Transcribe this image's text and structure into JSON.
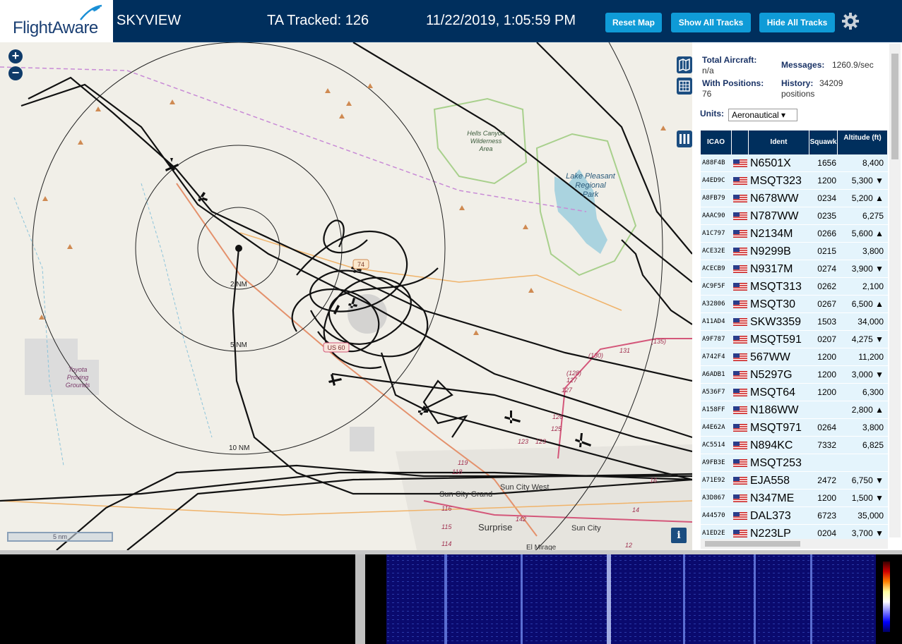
{
  "header": {
    "logo_text": "FlightAware",
    "site_name": "SKYVIEW",
    "tracked": "TA Tracked: 126",
    "datetime": "11/22/2019, 1:05:59 PM",
    "buttons": {
      "reset_map": "Reset Map",
      "show_tracks": "Show All Tracks",
      "hide_tracks": "Hide All Tracks"
    },
    "colors": {
      "bar": "#002f5d",
      "button": "#0f9bd7"
    }
  },
  "map": {
    "zoom_in": "+",
    "zoom_out": "−",
    "range_labels": [
      "2 NM",
      "5 NM",
      "10 NM"
    ],
    "place_labels": {
      "hells_canyon": [
        "Hells Canyon",
        "Wilderness",
        "Area"
      ],
      "lake_pleasant": [
        "Lake Pleasant",
        "Regional",
        "Park"
      ],
      "toyota": [
        "Toyota",
        "Proving",
        "Grounds"
      ],
      "sun_city_grand": "Sun City Grand",
      "sun_city_west": "Sun City West",
      "surprise": "Surprise",
      "sun_city": "Sun City",
      "el_mirage": "El Mirage"
    },
    "road_labels": [
      "US 60",
      "74"
    ],
    "route_numbers": [
      "131",
      "(135)",
      "(130)",
      "(128)",
      "127",
      "127",
      "126",
      "125",
      "123",
      "123",
      "119",
      "118",
      "116",
      "115",
      "114",
      "142",
      "16",
      "14",
      "12"
    ],
    "scale_label": "5 nm",
    "info": "i"
  },
  "panel": {
    "total_aircraft_label": "Total Aircraft:",
    "total_aircraft_value": "n/a",
    "messages_label": "Messages:",
    "messages_value": "1260.9/sec",
    "with_positions_label": "With Positions:",
    "with_positions_value": "76",
    "history_label": "History:",
    "history_value": "34209",
    "history_unit": "positions",
    "units_label": "Units:",
    "units_value": "Aeronautical ▾",
    "columns": [
      "ICAO",
      "",
      "Ident",
      "Squawk",
      "Altitude (ft)"
    ],
    "rows": [
      {
        "icao": "A88F4B",
        "ident": "N6501X",
        "squawk": "1656",
        "alt": "8,400"
      },
      {
        "icao": "A4ED9C",
        "ident": "MSQT323",
        "squawk": "1200",
        "alt": "5,300 ▼"
      },
      {
        "icao": "A8FB79",
        "ident": "N678WW",
        "squawk": "0234",
        "alt": "5,200 ▲"
      },
      {
        "icao": "AAAC90",
        "ident": "N787WW",
        "squawk": "0235",
        "alt": "6,275"
      },
      {
        "icao": "A1C797",
        "ident": "N2134M",
        "squawk": "0266",
        "alt": "5,600 ▲"
      },
      {
        "icao": "ACE32E",
        "ident": "N9299B",
        "squawk": "0215",
        "alt": "3,800"
      },
      {
        "icao": "ACECB9",
        "ident": "N9317M",
        "squawk": "0274",
        "alt": "3,900 ▼"
      },
      {
        "icao": "AC9F5F",
        "ident": "MSQT313",
        "squawk": "0262",
        "alt": "2,100"
      },
      {
        "icao": "A32806",
        "ident": "MSQT30",
        "squawk": "0267",
        "alt": "6,500 ▲"
      },
      {
        "icao": "A11AD4",
        "ident": "SKW3359",
        "squawk": "1503",
        "alt": "34,000"
      },
      {
        "icao": "A9F787",
        "ident": "MSQT591",
        "squawk": "0207",
        "alt": "4,275 ▼"
      },
      {
        "icao": "A742F4",
        "ident": "567WW",
        "squawk": "1200",
        "alt": "11,200"
      },
      {
        "icao": "A6ADB1",
        "ident": "N5297G",
        "squawk": "1200",
        "alt": "3,000 ▼"
      },
      {
        "icao": "A536F7",
        "ident": "MSQT64",
        "squawk": "1200",
        "alt": "6,300"
      },
      {
        "icao": "A158FF",
        "ident": "N186WW",
        "squawk": "",
        "alt": "2,800 ▲"
      },
      {
        "icao": "A4E62A",
        "ident": "MSQT971",
        "squawk": "0264",
        "alt": "3,800"
      },
      {
        "icao": "AC5514",
        "ident": "N894KC",
        "squawk": "7332",
        "alt": "6,825"
      },
      {
        "icao": "A9FB3E",
        "ident": "MSQT253",
        "squawk": "",
        "alt": ""
      },
      {
        "icao": "A71E92",
        "ident": "EJA558",
        "squawk": "2472",
        "alt": "6,750 ▼"
      },
      {
        "icao": "A3D867",
        "ident": "N347ME",
        "squawk": "1200",
        "alt": "1,500 ▼"
      },
      {
        "icao": "A44570",
        "ident": "DAL373",
        "squawk": "6723",
        "alt": "35,000"
      },
      {
        "icao": "A1ED2E",
        "ident": "N223LP",
        "squawk": "0204",
        "alt": "3,700 ▼"
      }
    ]
  }
}
